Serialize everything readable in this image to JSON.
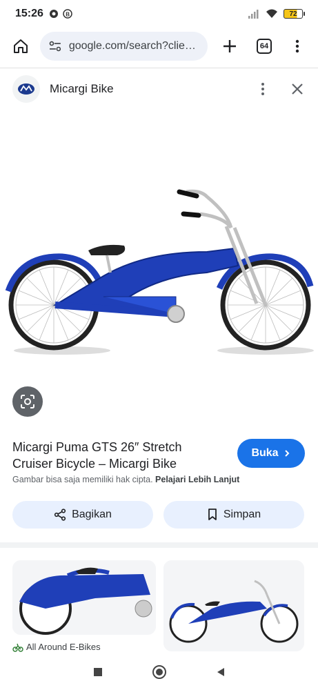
{
  "status_bar": {
    "time": "15:26",
    "battery": "72"
  },
  "toolbar": {
    "url": "google.com/search?client=",
    "tab_count": "64"
  },
  "source": {
    "name": "Micargi Bike"
  },
  "result": {
    "title": "Micargi Puma GTS 26″ Stretch Cruiser Bicycle – Micargi Bike",
    "visit_label": "Buka",
    "copyright_text": "Gambar bisa saja memiliki hak cipta.",
    "learn_more": "Pelajari Lebih Lanjut",
    "share_label": "Bagikan",
    "save_label": "Simpan"
  },
  "related": {
    "source_name": "All Around E-Bikes"
  },
  "colors": {
    "accent": "#1a73e8",
    "bike_blue": "#1f3fb8",
    "pill_bg": "#e8f0fe"
  },
  "icons": {
    "home": "home-icon",
    "tune": "site-settings-icon",
    "plus": "new-tab-icon",
    "menu": "more-vert-icon",
    "close": "close-icon",
    "lens": "lens-icon",
    "share": "share-icon",
    "bookmark": "bookmark-icon"
  }
}
